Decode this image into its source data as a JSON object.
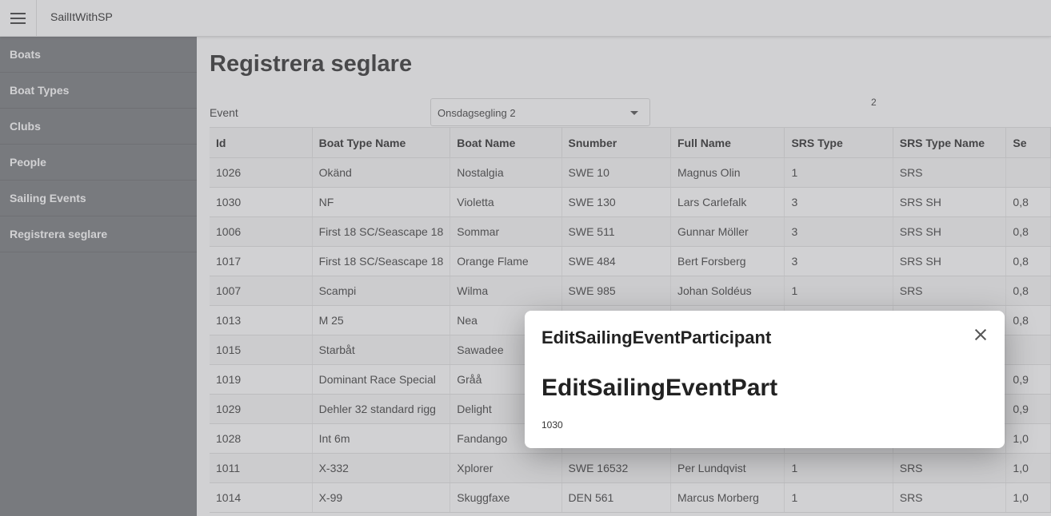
{
  "topbar": {
    "app_title": "SailItWithSP"
  },
  "sidebar": {
    "items": [
      {
        "label": "Boats"
      },
      {
        "label": "Boat Types"
      },
      {
        "label": "Clubs"
      },
      {
        "label": "People"
      },
      {
        "label": "Sailing Events"
      },
      {
        "label": "Registrera seglare"
      }
    ]
  },
  "main": {
    "title": "Registrera seglare",
    "event_label": "Event",
    "event_selected": "Onsdagsegling 2",
    "count": "2"
  },
  "table": {
    "columns": [
      "Id",
      "Boat Type Name",
      "Boat Name",
      "Snumber",
      "Full Name",
      "SRS Type",
      "SRS Type Name",
      "Se"
    ],
    "rows": [
      [
        "1026",
        "Okänd",
        "Nostalgia",
        "SWE 10",
        "Magnus Olin",
        "1",
        "SRS",
        ""
      ],
      [
        "1030",
        "NF",
        "Violetta",
        "SWE 130",
        "Lars Carlefalk",
        "3",
        "SRS SH",
        "0,8"
      ],
      [
        "1006",
        "First 18 SC/Seascape 18",
        "Sommar",
        "SWE 511",
        "Gunnar Möller",
        "3",
        "SRS SH",
        "0,8"
      ],
      [
        "1017",
        "First 18 SC/Seascape 18",
        "Orange Flame",
        "SWE 484",
        "Bert Forsberg",
        "3",
        "SRS SH",
        "0,8"
      ],
      [
        "1007",
        "Scampi",
        "Wilma",
        "SWE 985",
        "Johan Soldéus",
        "1",
        "SRS",
        "0,8"
      ],
      [
        "1013",
        "M 25",
        "Nea",
        "",
        "",
        "",
        "",
        "0,8"
      ],
      [
        "1015",
        "Starbåt",
        "Sawadee",
        "",
        "",
        "",
        "",
        ""
      ],
      [
        "1019",
        "Dominant Race Special",
        "Gråå",
        "",
        "",
        "",
        "",
        "0,9"
      ],
      [
        "1029",
        "Dehler 32 standard rigg",
        "Delight",
        "",
        "",
        "",
        "",
        "0,9"
      ],
      [
        "1028",
        "Int 6m",
        "Fandango",
        "",
        "",
        "",
        "",
        "1,0"
      ],
      [
        "1011",
        "X-332",
        "Xplorer",
        "SWE 16532",
        "Per Lundqvist",
        "1",
        "SRS",
        "1,0"
      ],
      [
        "1014",
        "X-99",
        "Skuggfaxe",
        "DEN 561",
        "Marcus Morberg",
        "1",
        "SRS",
        "1,0"
      ]
    ]
  },
  "modal": {
    "title": "EditSailingEventParticipant",
    "heading": "EditSailingEventPart",
    "value": "1030"
  }
}
